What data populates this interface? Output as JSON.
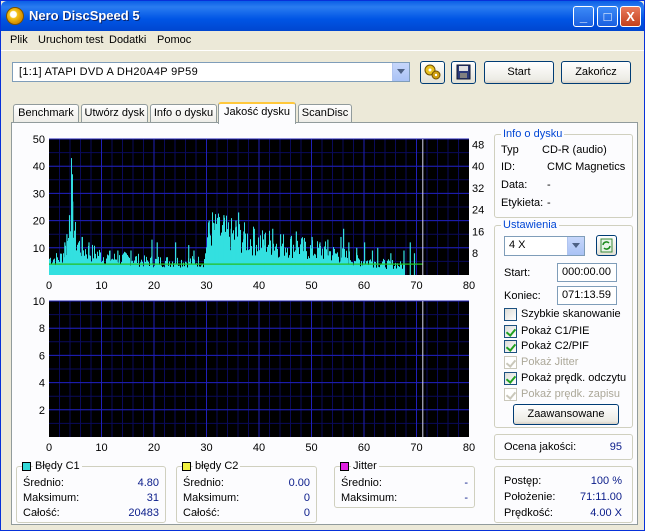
{
  "window": {
    "title": "Nero DiscSpeed 5",
    "minimize": "_",
    "maximize": "□",
    "close": "X"
  },
  "menu": [
    "Plik",
    "Uruchom test",
    "Dodatki",
    "Pomoc"
  ],
  "toolbar": {
    "drive": "[1:1]   ATAPI DVD A  DH20A4P 9P59",
    "start_label": "Start",
    "end_label": "Zakończ"
  },
  "tabs": [
    "Benchmark",
    "Utwórz dysk",
    "Info o dysku",
    "Jakość dysku",
    "ScanDisc"
  ],
  "active_tab": "Jakość dysku",
  "disc_info": {
    "title": "Info o dysku",
    "type_label": "Typ",
    "type_value": "CD-R (audio)",
    "id_label": "ID:",
    "id_value": "CMC Magnetics",
    "date_label": "Data:",
    "date_value": "-",
    "label_label": "Etykieta:",
    "label_value": "-"
  },
  "settings": {
    "title": "Ustawienia",
    "speed": "4 X",
    "start_label": "Start:",
    "start_value": "000:00.00",
    "end_label": "Koniec:",
    "end_value": "071:13.59",
    "checkboxes": [
      {
        "label": "Szybkie skanowanie",
        "checked": false,
        "enabled": true
      },
      {
        "label": "Pokaż C1/PIE",
        "checked": true,
        "enabled": true
      },
      {
        "label": "Pokaż C2/PIF",
        "checked": true,
        "enabled": true
      },
      {
        "label": "Pokaż Jitter",
        "checked": true,
        "enabled": false
      },
      {
        "label": "Pokaż prędk. odczytu",
        "checked": true,
        "enabled": true
      },
      {
        "label": "Pokaż prędk. zapisu",
        "checked": true,
        "enabled": false
      }
    ],
    "advanced_label": "Zaawansowane"
  },
  "quality": {
    "label": "Ocena jakości:",
    "value": "95"
  },
  "progress": {
    "progress_label": "Postęp:",
    "progress_value": "100 %",
    "position_label": "Położenie:",
    "position_value": "71:11.00",
    "speed_label": "Prędkość:",
    "speed_value": "4.00 X"
  },
  "stats": {
    "c1": {
      "title": "Błędy C1",
      "color": "#33d8d8",
      "avg_label": "Średnio:",
      "avg": "4.80",
      "max_label": "Maksimum:",
      "max": "31",
      "total_label": "Całość:",
      "total": "20483"
    },
    "c2": {
      "title": "błędy C2",
      "color": "#f0f040",
      "avg_label": "Średnio:",
      "avg": "0.00",
      "max_label": "Maksimum:",
      "max": "0",
      "total_label": "Całość:",
      "total": "0"
    },
    "jitter": {
      "title": "Jitter",
      "color": "#e020e0",
      "avg_label": "Średnio:",
      "avg": "-",
      "max_label": "Maksimum:",
      "max": "-"
    }
  },
  "chart_data": [
    {
      "type": "bar",
      "x_ticks": [
        "0",
        "10",
        "20",
        "30",
        "40",
        "50",
        "60",
        "70",
        "80"
      ],
      "y_ticks_left": [
        "10",
        "20",
        "30",
        "40",
        "50"
      ],
      "y_ticks_right": [
        "8",
        "16",
        "24",
        "32",
        "40",
        "48"
      ],
      "xlim": [
        0,
        80
      ],
      "ylim": [
        0,
        50
      ],
      "y2lim": [
        0,
        50
      ],
      "marker_x": 71.2,
      "bar_color": "#33e0e0",
      "speed_line_color": "#22c022",
      "read_speed_x": 71.2,
      "read_speed": 4,
      "c1_profile": [
        [
          0,
          6
        ],
        [
          2,
          6
        ],
        [
          3,
          9
        ],
        [
          3.6,
          13
        ],
        [
          3.9,
          25
        ],
        [
          4.2,
          31
        ],
        [
          4.6,
          20
        ],
        [
          5,
          13
        ],
        [
          6,
          10
        ],
        [
          7,
          9
        ],
        [
          8,
          8
        ],
        [
          9,
          8
        ],
        [
          10,
          7
        ],
        [
          12,
          6
        ],
        [
          14,
          6
        ],
        [
          16,
          6
        ],
        [
          18,
          5
        ],
        [
          20,
          5
        ],
        [
          22,
          5
        ],
        [
          24,
          5
        ],
        [
          26,
          5
        ],
        [
          28,
          5
        ],
        [
          29.5,
          5
        ],
        [
          30,
          13
        ],
        [
          31,
          17
        ],
        [
          32,
          16
        ],
        [
          34,
          15
        ],
        [
          36,
          14
        ],
        [
          38,
          13
        ],
        [
          40,
          12
        ],
        [
          42,
          12
        ],
        [
          44,
          11
        ],
        [
          46,
          11
        ],
        [
          48,
          10
        ],
        [
          50,
          9
        ],
        [
          52,
          9
        ],
        [
          54,
          8
        ],
        [
          56,
          7
        ],
        [
          58,
          6
        ],
        [
          60,
          5
        ],
        [
          62,
          5
        ],
        [
          64,
          4
        ],
        [
          66,
          4
        ],
        [
          68,
          3
        ],
        [
          71.2,
          3
        ]
      ],
      "c1_spikes": [
        [
          2.9,
          12
        ],
        [
          3.3,
          15
        ],
        [
          3.8,
          22
        ],
        [
          4.2,
          31
        ],
        [
          4.4,
          27
        ],
        [
          6.2,
          14
        ],
        [
          7.5,
          12
        ],
        [
          11.5,
          9
        ],
        [
          13,
          9
        ],
        [
          15.5,
          9
        ],
        [
          19.5,
          13
        ],
        [
          20.5,
          12
        ],
        [
          24,
          12
        ],
        [
          26.5,
          11
        ],
        [
          27.5,
          9
        ],
        [
          30.4,
          20
        ],
        [
          31.5,
          19
        ],
        [
          32,
          21
        ],
        [
          33.2,
          22
        ],
        [
          34.6,
          17
        ],
        [
          35.5,
          20
        ],
        [
          36,
          23
        ],
        [
          37,
          16
        ],
        [
          39,
          17
        ],
        [
          41,
          15
        ],
        [
          42.5,
          17
        ],
        [
          44,
          15
        ],
        [
          46,
          14
        ],
        [
          47,
          16
        ],
        [
          48.5,
          13
        ],
        [
          50,
          14
        ],
        [
          51.5,
          12
        ],
        [
          53,
          13
        ],
        [
          55.5,
          14
        ],
        [
          56,
          17
        ],
        [
          57,
          12
        ],
        [
          58.5,
          10
        ],
        [
          60,
          12
        ],
        [
          61.5,
          9
        ],
        [
          62.5,
          10
        ],
        [
          65,
          8
        ],
        [
          67.5,
          9
        ],
        [
          68.7,
          12
        ],
        [
          69.5,
          8
        ]
      ]
    },
    {
      "type": "bar",
      "x_ticks": [
        "0",
        "10",
        "20",
        "30",
        "40",
        "50",
        "60",
        "70",
        "80"
      ],
      "y_ticks_left": [
        "2",
        "4",
        "6",
        "8",
        "10"
      ],
      "xlim": [
        0,
        80
      ],
      "ylim": [
        0,
        10
      ],
      "marker_x": 71.2,
      "values": []
    }
  ]
}
